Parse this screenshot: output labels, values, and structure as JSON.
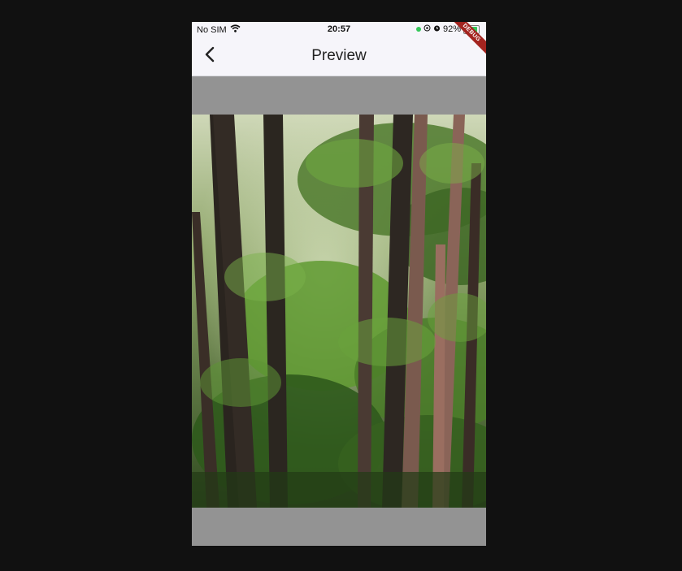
{
  "status_bar": {
    "carrier": "No SIM",
    "time": "20:57",
    "battery_percent": "92%",
    "battery_level": 0.92
  },
  "app_bar": {
    "title": "Preview",
    "debug_banner": "DEBUG"
  },
  "colors": {
    "page_background": "#111111",
    "bar_background": "#f6f5fa",
    "image_backdrop": "#939393",
    "debug_ribbon": "#a3241f"
  },
  "icons": {
    "back": "chevron-left-icon",
    "wifi": "wifi-icon",
    "location": "location-icon",
    "alarm": "alarm-icon",
    "battery": "battery-charging-icon"
  }
}
